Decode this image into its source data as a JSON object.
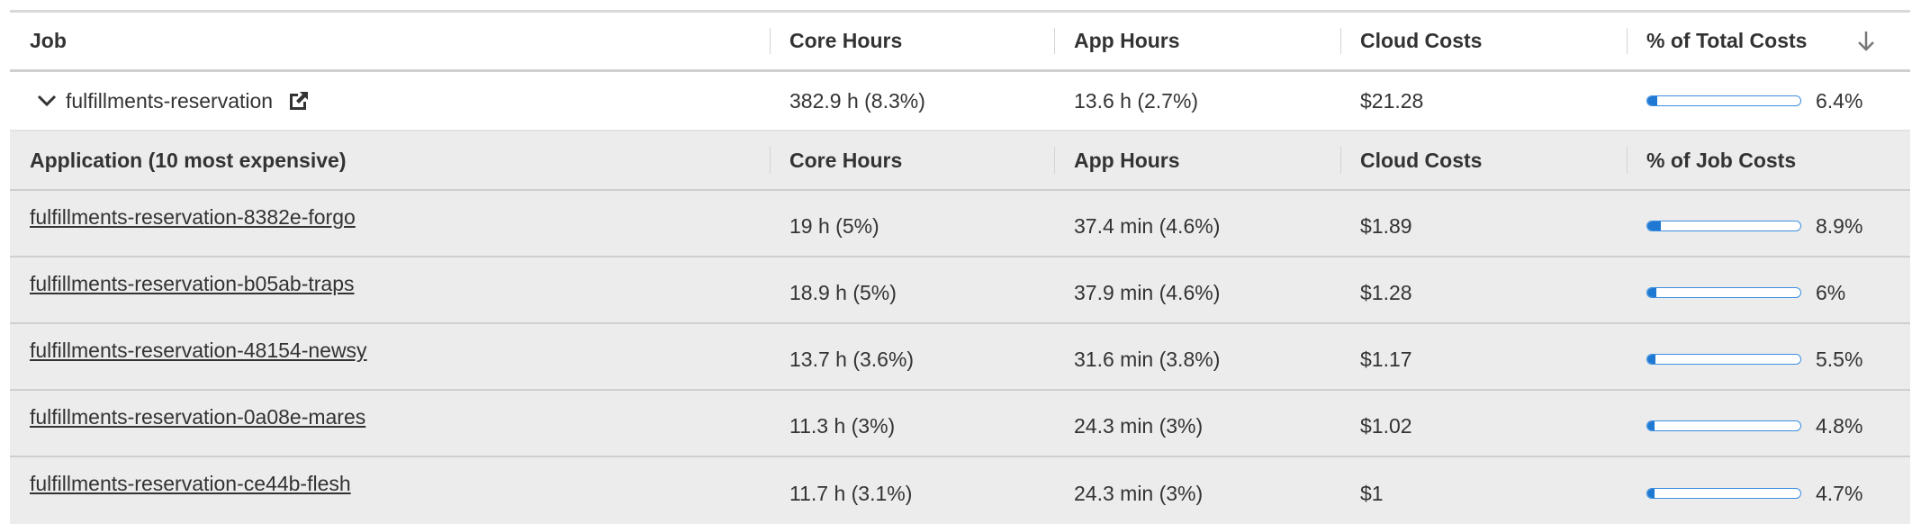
{
  "header": {
    "col_job": "Job",
    "col_core": "Core Hours",
    "col_app": "App Hours",
    "col_cloud": "Cloud Costs",
    "col_pct": "% of Total Costs",
    "sort_icon": "arrow-down-icon"
  },
  "job": {
    "name": "fulfillments-reservation",
    "core_hours": "382.9 h (8.3%)",
    "app_hours": "13.6 h (2.7%)",
    "cloud_costs": "$21.28",
    "pct": "6.4%",
    "pct_value": 6.4,
    "expand_icon": "chevron-down-icon",
    "external_icon": "external-link-icon"
  },
  "sub_header": {
    "col_app": "Application (10 most expensive)",
    "col_core": "Core Hours",
    "col_app_hours": "App Hours",
    "col_cloud": "Cloud Costs",
    "col_pct": "% of Job Costs"
  },
  "apps": [
    {
      "name": "fulfillments-reservation-8382e-forgo",
      "core_hours": "19 h (5%)",
      "app_hours": "37.4 min (4.6%)",
      "cloud_costs": "$1.89",
      "pct": "8.9%",
      "pct_value": 8.9
    },
    {
      "name": "fulfillments-reservation-b05ab-traps",
      "core_hours": "18.9 h (5%)",
      "app_hours": "37.9 min (4.6%)",
      "cloud_costs": "$1.28",
      "pct": "6%",
      "pct_value": 6.0
    },
    {
      "name": "fulfillments-reservation-48154-newsy",
      "core_hours": "13.7 h (3.6%)",
      "app_hours": "31.6 min (3.8%)",
      "cloud_costs": "$1.17",
      "pct": "5.5%",
      "pct_value": 5.5
    },
    {
      "name": "fulfillments-reservation-0a08e-mares",
      "core_hours": "11.3 h (3%)",
      "app_hours": "24.3 min (3%)",
      "cloud_costs": "$1.02",
      "pct": "4.8%",
      "pct_value": 4.8
    },
    {
      "name": "fulfillments-reservation-ce44b-flesh",
      "core_hours": "11.7 h (3.1%)",
      "app_hours": "24.3 min (3%)",
      "cloud_costs": "$1",
      "pct": "4.7%",
      "pct_value": 4.7
    }
  ],
  "colors": {
    "bar_fill": "#1f78d1",
    "bar_border": "#3d8fe0",
    "row_bg": "#ececec"
  }
}
